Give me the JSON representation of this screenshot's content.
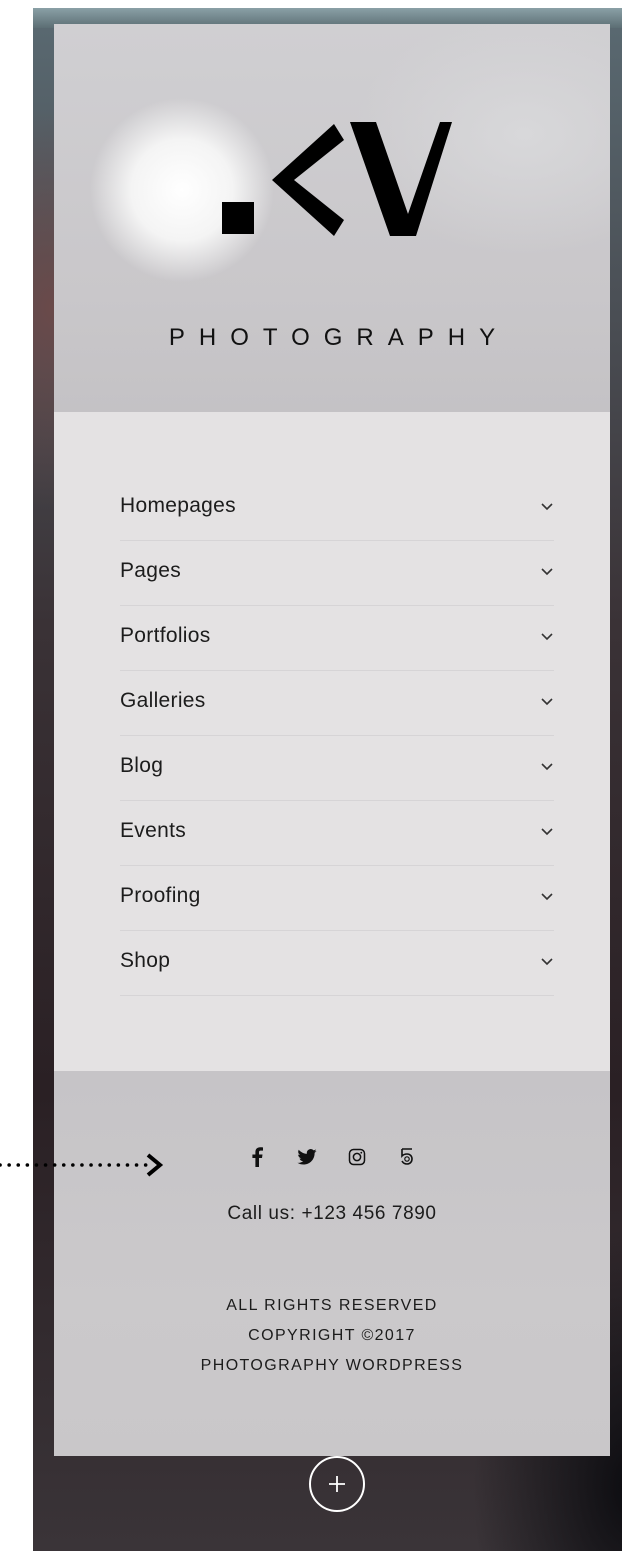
{
  "brand": {
    "logo_text": ".KV",
    "subtitle": "PHOTOGRAPHY"
  },
  "menu": {
    "items": [
      {
        "label": "Homepages",
        "icon": "chevron-down-icon"
      },
      {
        "label": "Pages",
        "icon": "chevron-down-icon"
      },
      {
        "label": "Portfolios",
        "icon": "chevron-down-icon"
      },
      {
        "label": "Galleries",
        "icon": "chevron-down-icon"
      },
      {
        "label": "Blog",
        "icon": "chevron-down-icon"
      },
      {
        "label": "Events",
        "icon": "chevron-down-icon"
      },
      {
        "label": "Proofing",
        "icon": "chevron-down-icon"
      },
      {
        "label": "Shop",
        "icon": "chevron-down-icon"
      }
    ]
  },
  "footer": {
    "social_icons": [
      "facebook-icon",
      "twitter-icon",
      "instagram-icon",
      "500px-icon"
    ],
    "call_text": "Call us: +123 456 7890",
    "legal_lines": [
      "ALL RIGHTS RESERVED",
      "COPYRIGHT ©2017",
      "PHOTOGRAPHY WORDPRESS"
    ]
  },
  "controls": {
    "expand_icon": "plus-icon"
  },
  "colors": {
    "panel_bg": "#e4e2e3",
    "header_bg": "#c9c7ca",
    "footer_bg": "#c8c6c8",
    "text": "#1c1c1c"
  }
}
